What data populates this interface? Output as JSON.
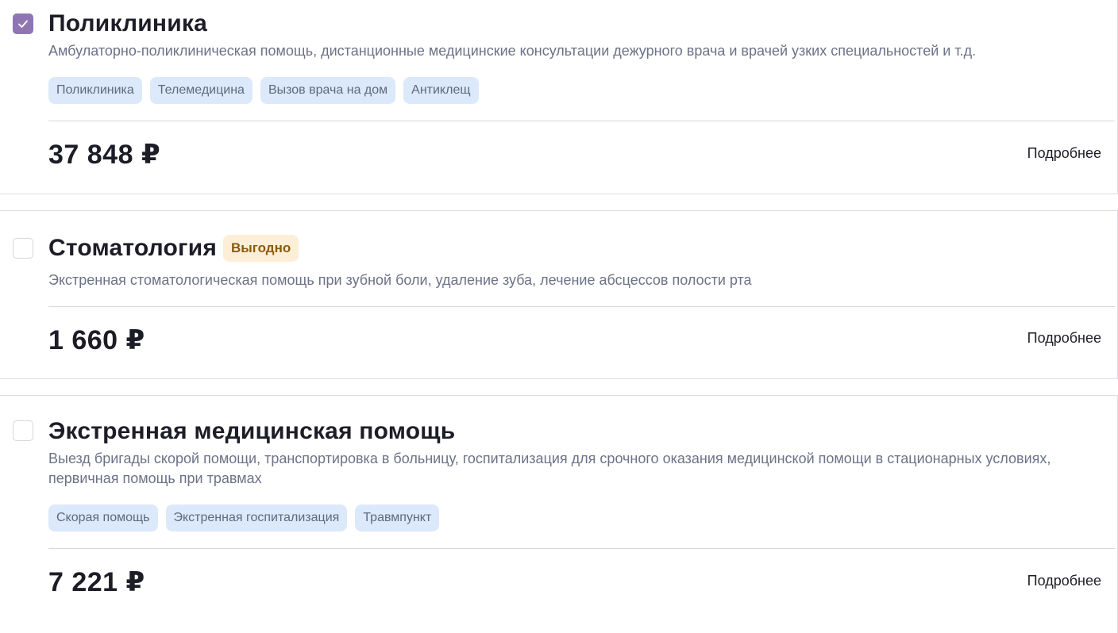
{
  "products": [
    {
      "checked": true,
      "title": "Поликлиника",
      "badge": "",
      "description": "Амбулаторно-поликлиническая помощь, дистанционные медицинские консультации дежурного врача и врачей узких специальностей и т.д.",
      "tags": [
        "Поликлиника",
        "Телемедицина",
        "Вызов врача на дом",
        "Антиклещ"
      ],
      "price": "37 848 ₽",
      "more_label": "Подробнее"
    },
    {
      "checked": false,
      "title": "Стоматология",
      "badge": "Выгодно",
      "description": "Экстренная стоматологическая помощь при зубной боли, удаление зуба, лечение абсцессов полости рта",
      "tags": [],
      "price": "1 660 ₽",
      "more_label": "Подробнее"
    },
    {
      "checked": false,
      "title": "Экстренная медицинская помощь",
      "badge": "",
      "description": "Выезд бригады скорой помощи, транспортировка в больницу, госпитализация для срочного оказания медицинской помощи в стационарных условиях, первичная помощь при травмах",
      "tags": [
        "Скорая помощь",
        "Экстренная госпитализация",
        "Травмпункт"
      ],
      "price": "7 221 ₽",
      "more_label": "Подробнее"
    }
  ],
  "colors": {
    "checkbox_checked": "#8f76b3",
    "tag_bg": "#dce9fb",
    "badge_bg": "#fdeed8",
    "badge_text": "#8a5a0a",
    "description_text": "#6c7287"
  }
}
